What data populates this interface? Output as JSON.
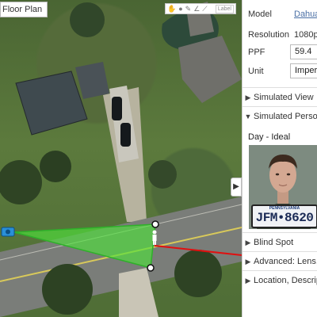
{
  "map": {
    "floor_plan_label": "Floor Plan",
    "toolbar": {
      "tools": [
        "✋",
        "●",
        "✎",
        "∠",
        "⟋"
      ],
      "label_button": "Label"
    },
    "collapse_arrow": "▶"
  },
  "panel": {
    "model_label": "Model",
    "model_value": "Dahua",
    "resolution_label": "Resolution",
    "resolution_value": "1080p",
    "ppf_label": "PPF",
    "ppf_value": "59.4",
    "unit_label": "Unit",
    "unit_value": "Imperial",
    "sections": {
      "simulated_view": {
        "label": "Simulated View",
        "chevron": "▶"
      },
      "simulated_person": {
        "label": "Simulated Person",
        "chevron": "▼"
      },
      "blind_spot": {
        "label": "Blind Spot",
        "chevron": "▶"
      },
      "advanced": {
        "label": "Advanced: Lens, ...",
        "chevron": "▶"
      },
      "location": {
        "label": "Location, Description",
        "chevron": "▶"
      }
    },
    "sim_condition": "Day - Ideal",
    "plate": {
      "state": "PENNSYLVANIA",
      "number": "JFM•8620"
    }
  },
  "colors": {
    "fov_fill": "#4ee23a",
    "camera": "#2a8fd8",
    "blind_line": "#e01010",
    "link": "#4a6fa5"
  }
}
